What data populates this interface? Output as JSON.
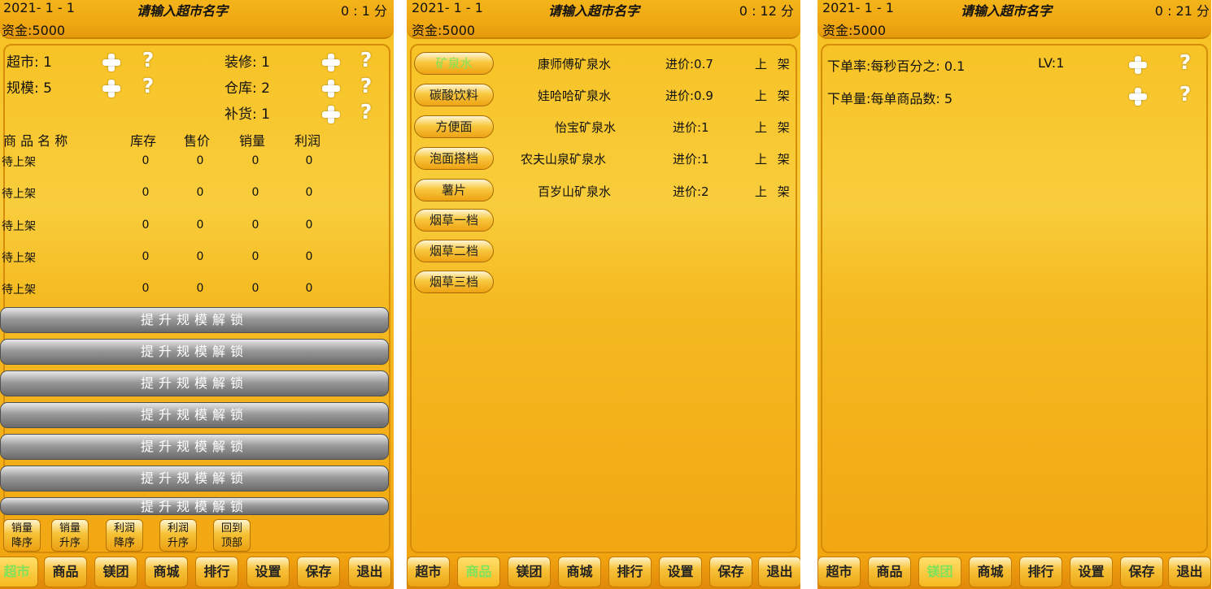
{
  "header": {
    "date": "2021- 1 - 1",
    "market_name": "请输入超市名字",
    "money": "资金:5000"
  },
  "screens": {
    "s1": {
      "time": "0 : 1 分"
    },
    "s2": {
      "time": "0 : 12 分"
    },
    "s3": {
      "time": "0 : 21 分"
    }
  },
  "market_panel": {
    "supermarket": "超市: 1",
    "scale": "规模: 5",
    "decoration": "装修: 1",
    "warehouse": "仓库: 2",
    "restock": "补货: 1",
    "question": "?",
    "columns": [
      "商 品 名 称",
      "库存",
      "售价",
      "销量",
      "利润"
    ],
    "rows": [
      {
        "name": "待上架",
        "stock": "0",
        "price": "0",
        "sales": "0",
        "profit": "0"
      },
      {
        "name": "待上架",
        "stock": "0",
        "price": "0",
        "sales": "0",
        "profit": "0"
      },
      {
        "name": "待上架",
        "stock": "0",
        "price": "0",
        "sales": "0",
        "profit": "0"
      },
      {
        "name": "待上架",
        "stock": "0",
        "price": "0",
        "sales": "0",
        "profit": "0"
      },
      {
        "name": "待上架",
        "stock": "0",
        "price": "0",
        "sales": "0",
        "profit": "0"
      }
    ],
    "unlock_label": "提升规模解锁",
    "sort_buttons": [
      {
        "line1": "销量",
        "line2": "降序"
      },
      {
        "line1": "销量",
        "line2": "升序"
      },
      {
        "line1": "利润",
        "line2": "降序"
      },
      {
        "line1": "利润",
        "line2": "升序"
      },
      {
        "line1": "回到",
        "line2": "顶部"
      }
    ]
  },
  "goods_panel": {
    "categories": [
      "矿泉水",
      "碳酸饮料",
      "方便面",
      "泡面搭档",
      "薯片",
      "烟草一档",
      "烟草二档",
      "烟草三档"
    ],
    "products": [
      {
        "name": "康师傅矿泉水",
        "price": "进价:0.7",
        "action": "上 架"
      },
      {
        "name": "娃哈哈矿泉水",
        "price": "进价:0.9",
        "action": "上 架"
      },
      {
        "name": "怡宝矿泉水",
        "price": "进价:1",
        "action": "上 架"
      },
      {
        "name": "农夫山泉矿泉水",
        "price": "进价:1",
        "action": "上 架"
      },
      {
        "name": "百岁山矿泉水",
        "price": "进价:2",
        "action": "上 架"
      }
    ]
  },
  "meituan_panel": {
    "order_rate": "下单率:每秒百分之: 0.1",
    "level": "LV:1",
    "order_qty": "下单量:每单商品数:  5"
  },
  "nav": [
    "超市",
    "商品",
    "镁团",
    "商城",
    "排行",
    "设置",
    "保存",
    "退出"
  ],
  "colors": {
    "active_tab_text": "#7ee35a",
    "background_yellow": "#f7c020",
    "unlock_gray": "#8a8a8a"
  }
}
